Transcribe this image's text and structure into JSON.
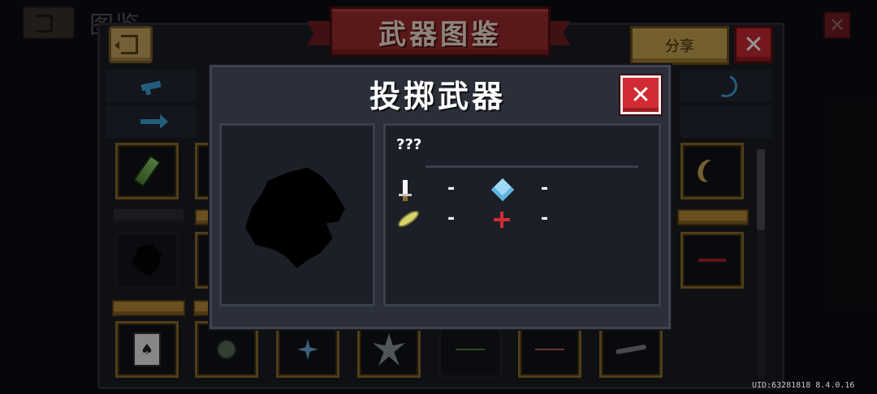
{
  "background_screen": {
    "title": "图鉴"
  },
  "window": {
    "title": "武器图鉴",
    "share_label": "分享",
    "close_symbol": "✕",
    "card_symbol": "♠"
  },
  "popup": {
    "title": "投掷武器",
    "close_symbol": "✕",
    "item_name": "???",
    "stats": [
      {
        "icon": "sword-icon",
        "value": "-"
      },
      {
        "icon": "crystal-icon",
        "value": "-"
      },
      {
        "icon": "feather-icon",
        "value": "-"
      },
      {
        "icon": "crosshair-icon",
        "value": "-"
      }
    ]
  },
  "footer": {
    "uid": "UID:63281818 8.4.0.16"
  },
  "colors": {
    "accent_gold": "#c9a451",
    "close_red": "#d22b33",
    "tab_blue": "#3ea0d6"
  }
}
